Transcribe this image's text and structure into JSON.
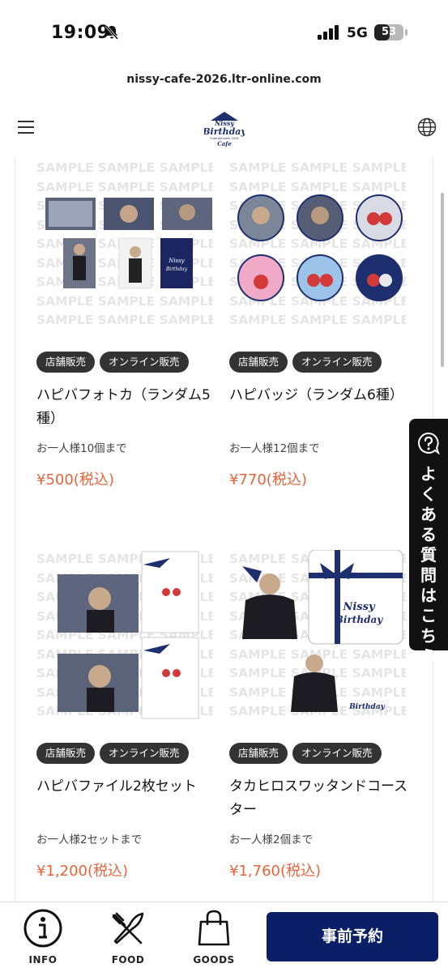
{
  "status_bar": {
    "time": "19:09",
    "network": "5G",
    "battery": "53",
    "battery_level_percent": 53
  },
  "browser": {
    "url": "nissy-cafe-2026.ltr-online.com"
  },
  "header": {
    "logo_lines": [
      "Nissy",
      "Birthday",
      "Entertainment 2026",
      "Cafe"
    ]
  },
  "watermark": "SAMPLE SAMPLE SAMPLE",
  "products": [
    {
      "tags": [
        "店舗販売",
        "オンライン販売"
      ],
      "name": "ハピバフォトカ（ランダム5種）",
      "limit": "お一人様10個まで",
      "price": "¥500(税込)"
    },
    {
      "tags": [
        "店舗販売",
        "オンライン販売"
      ],
      "name": "ハピバッジ（ランダム6種）",
      "limit": "お一人様12個まで",
      "price": "¥770(税込)"
    },
    {
      "tags": [
        "店舗販売",
        "オンライン販売"
      ],
      "name": "ハピバファイル2枚セット",
      "limit": "お一人様2セットまで",
      "price": "¥1,200(税込)"
    },
    {
      "tags": [
        "店舗販売",
        "オンライン販売"
      ],
      "name": "タカヒロスワッタンドコースター",
      "limit": "お一人様2個まで",
      "price": "¥1,760(税込)"
    }
  ],
  "faq_tab": {
    "label": "よくある質問はこちら"
  },
  "bottom_nav": {
    "items": [
      {
        "label": "INFO",
        "icon": "info-icon"
      },
      {
        "label": "FOOD",
        "icon": "fork-knife-icon"
      },
      {
        "label": "GOODS",
        "icon": "shopping-bag-icon"
      }
    ],
    "reserve_label": "事前予約"
  },
  "colors": {
    "price": "#e8643c",
    "tag_bg": "#333333",
    "reserve_button": "#0b1f66",
    "faq_tab": "#111111",
    "logo_navy": "#1d2f6f"
  }
}
